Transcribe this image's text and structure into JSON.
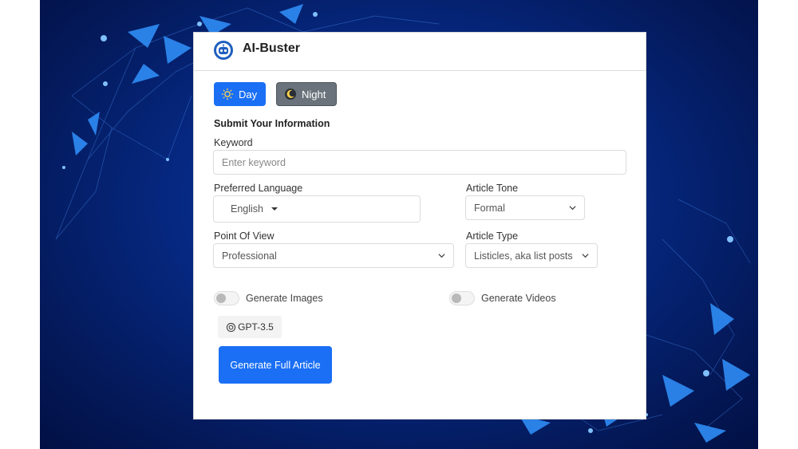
{
  "app": {
    "name": "AI-Buster"
  },
  "theme": {
    "day_label": "Day",
    "night_label": "Night",
    "accent": "#1a6ff5",
    "night_color": "#6a737b"
  },
  "form": {
    "title": "Submit Your Information",
    "keyword": {
      "label": "Keyword",
      "placeholder": "Enter keyword",
      "value": ""
    },
    "language": {
      "label": "Preferred Language",
      "value": "English"
    },
    "tone": {
      "label": "Article Tone",
      "value": "Formal"
    },
    "point_of_view": {
      "label": "Point Of View",
      "value": "Professional"
    },
    "article_type": {
      "label": "Article Type",
      "value": "Listicles, aka list posts"
    },
    "generate_images": {
      "label": "Generate Images",
      "on": false
    },
    "generate_videos": {
      "label": "Generate Videos",
      "on": false
    },
    "model": {
      "label": "GPT-3.5"
    },
    "submit_label": "Generate Full Article"
  }
}
